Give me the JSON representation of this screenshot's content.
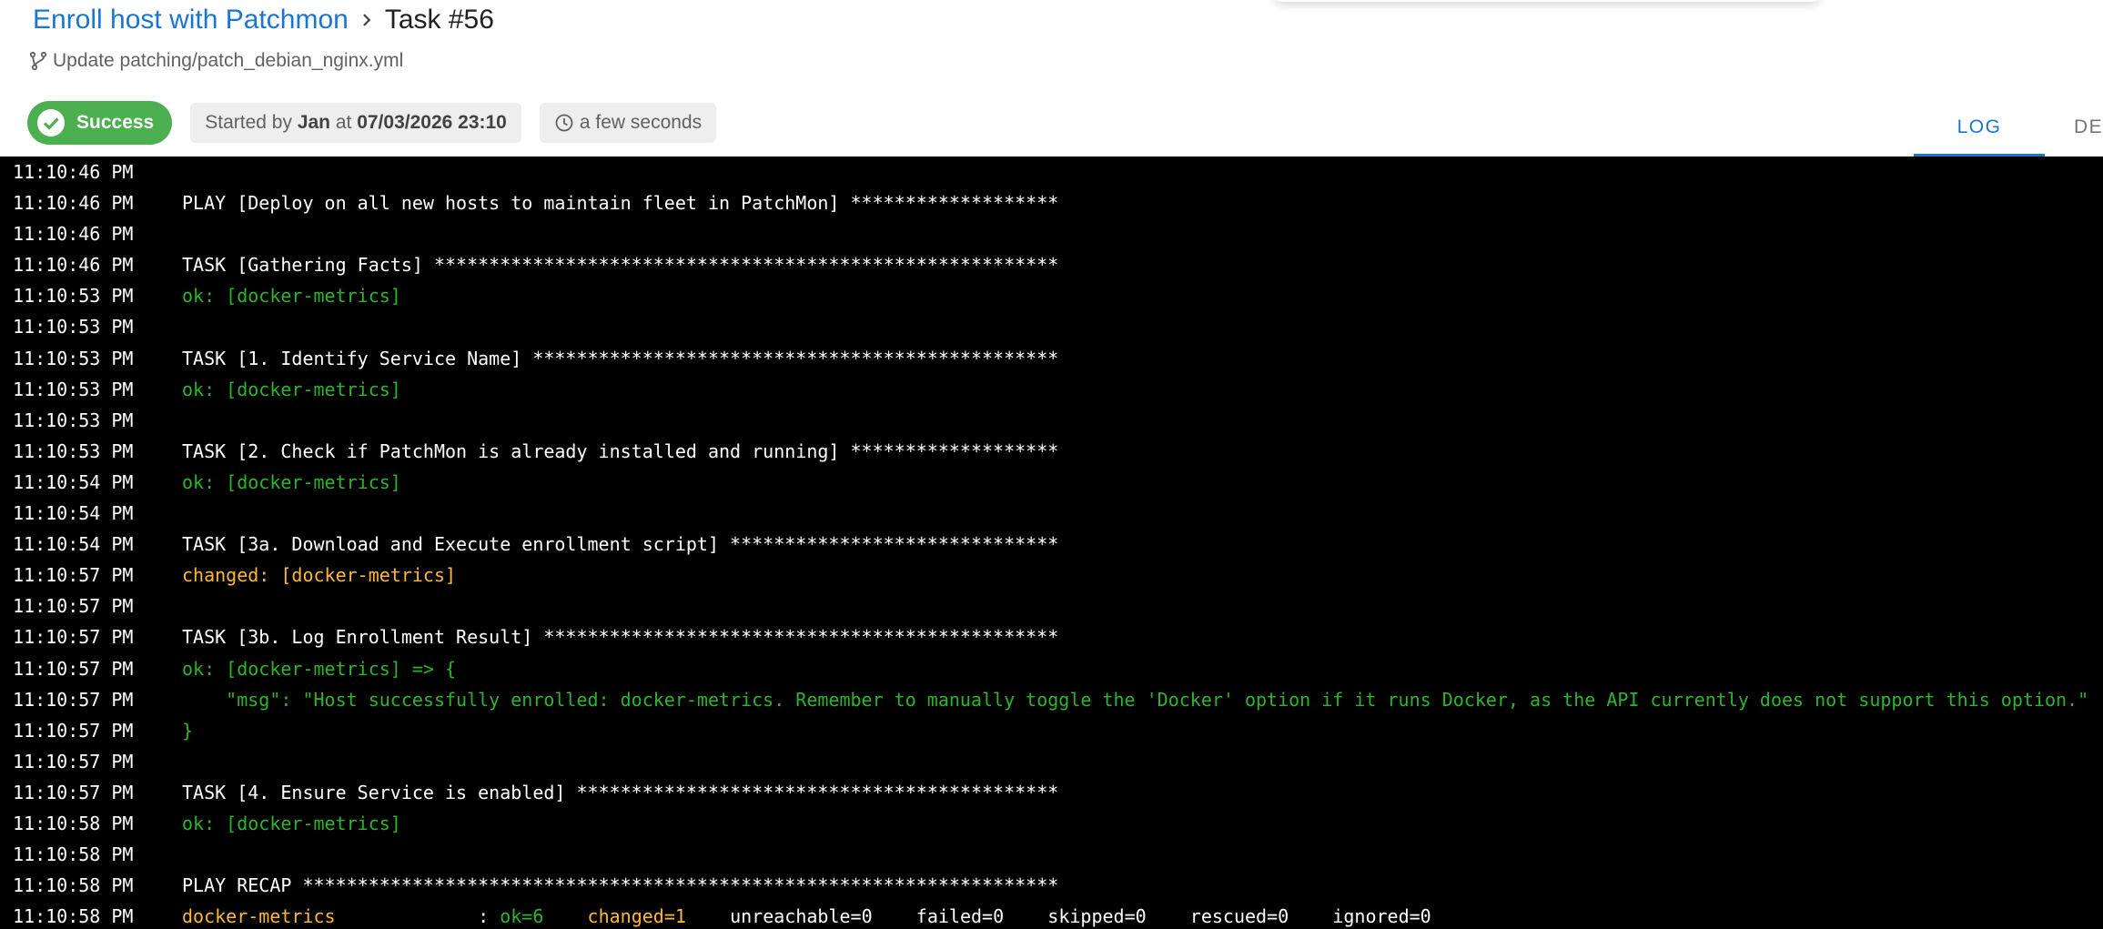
{
  "header": {
    "template_name": "Enroll host with Patchmon",
    "task_title": "Task #56",
    "commit_message": "Update patching/patch_debian_nginx.yml"
  },
  "status": {
    "label": "Success",
    "started_prefix": "Started by",
    "user": "Jan",
    "at_word": "at",
    "started_at": "07/03/2026 23:10",
    "duration": "a few seconds"
  },
  "tabs": [
    {
      "label": "LOG",
      "active": true
    },
    {
      "label": "DET",
      "active": false
    }
  ],
  "colors": {
    "accent": "#1976d2",
    "success": "#4caf50",
    "ok_text": "#2cb52c",
    "changed_text": "#ffb833",
    "log_background": "#000000"
  },
  "log": [
    {
      "time": "11:10:46 PM",
      "parts": []
    },
    {
      "time": "11:10:46 PM",
      "parts": [
        {
          "text": "PLAY [Deploy on all new hosts to maintain fleet in PatchMon] *******************",
          "color": "white"
        }
      ]
    },
    {
      "time": "11:10:46 PM",
      "parts": []
    },
    {
      "time": "11:10:46 PM",
      "parts": [
        {
          "text": "TASK [Gathering Facts] *********************************************************",
          "color": "white"
        }
      ]
    },
    {
      "time": "11:10:53 PM",
      "parts": [
        {
          "text": "ok: [docker-metrics]",
          "color": "ok"
        }
      ]
    },
    {
      "time": "11:10:53 PM",
      "parts": []
    },
    {
      "time": "11:10:53 PM",
      "parts": [
        {
          "text": "TASK [1. Identify Service Name] ************************************************",
          "color": "white"
        }
      ]
    },
    {
      "time": "11:10:53 PM",
      "parts": [
        {
          "text": "ok: [docker-metrics]",
          "color": "ok"
        }
      ]
    },
    {
      "time": "11:10:53 PM",
      "parts": []
    },
    {
      "time": "11:10:53 PM",
      "parts": [
        {
          "text": "TASK [2. Check if PatchMon is already installed and running] *******************",
          "color": "white"
        }
      ]
    },
    {
      "time": "11:10:54 PM",
      "parts": [
        {
          "text": "ok: [docker-metrics]",
          "color": "ok"
        }
      ]
    },
    {
      "time": "11:10:54 PM",
      "parts": []
    },
    {
      "time": "11:10:54 PM",
      "parts": [
        {
          "text": "TASK [3a. Download and Execute enrollment script] ******************************",
          "color": "white"
        }
      ]
    },
    {
      "time": "11:10:57 PM",
      "parts": [
        {
          "text": "changed: [docker-metrics]",
          "color": "changed"
        }
      ]
    },
    {
      "time": "11:10:57 PM",
      "parts": []
    },
    {
      "time": "11:10:57 PM",
      "parts": [
        {
          "text": "TASK [3b. Log Enrollment Result] ***********************************************",
          "color": "white"
        }
      ]
    },
    {
      "time": "11:10:57 PM",
      "parts": [
        {
          "text": "ok: [docker-metrics] => {",
          "color": "ok"
        }
      ]
    },
    {
      "time": "11:10:57 PM",
      "parts": [
        {
          "text": "    \"msg\": \"Host successfully enrolled: docker-metrics. Remember to manually toggle the 'Docker' option if it runs Docker, as the API currently does not support this option.\"",
          "color": "ok"
        }
      ]
    },
    {
      "time": "11:10:57 PM",
      "parts": [
        {
          "text": "}",
          "color": "ok"
        }
      ]
    },
    {
      "time": "11:10:57 PM",
      "parts": []
    },
    {
      "time": "11:10:57 PM",
      "parts": [
        {
          "text": "TASK [4. Ensure Service is enabled] ********************************************",
          "color": "white"
        }
      ]
    },
    {
      "time": "11:10:58 PM",
      "parts": [
        {
          "text": "ok: [docker-metrics]",
          "color": "ok"
        }
      ]
    },
    {
      "time": "11:10:58 PM",
      "parts": []
    },
    {
      "time": "11:10:58 PM",
      "parts": [
        {
          "text": "PLAY RECAP *********************************************************************",
          "color": "white"
        }
      ]
    },
    {
      "time": "11:10:58 PM",
      "parts": [
        {
          "text": "docker-metrics",
          "color": "changed"
        },
        {
          "text": "             : ",
          "color": "white"
        },
        {
          "text": "ok=6",
          "color": "ok"
        },
        {
          "text": "    ",
          "color": "white"
        },
        {
          "text": "changed=1",
          "color": "changed"
        },
        {
          "text": "    unreachable=0    failed=0    skipped=0    rescued=0    ignored=0",
          "color": "white"
        }
      ]
    }
  ]
}
